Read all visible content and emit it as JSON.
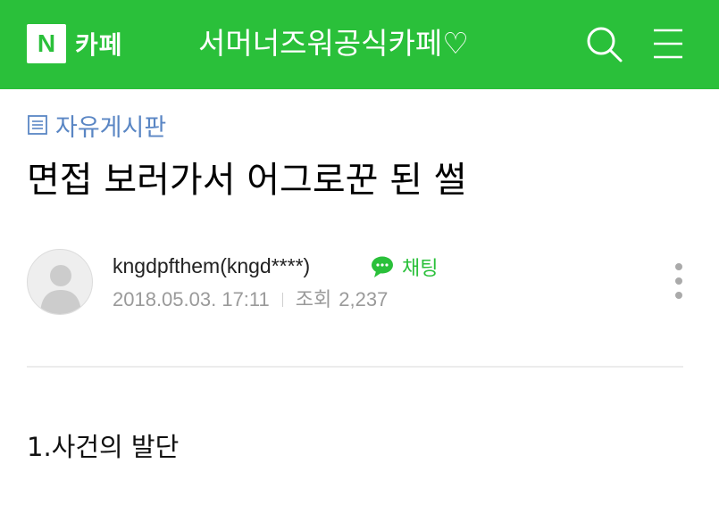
{
  "header": {
    "logo_badge": "N",
    "logo_text": "카페",
    "cafe_name": "서머너즈워공식카페♡",
    "background_color": "#2ac03a",
    "search_icon": "search-icon",
    "menu_icon": "hamburger-menu-icon"
  },
  "post": {
    "board_name": "자유게시판",
    "title": "면접 보러가서 어그로꾼 된 썰",
    "author": "kngdpfthem(kngd****)",
    "chat_label": "채팅",
    "date": "2018.05.03. 17:11",
    "views_label": "조회",
    "views": "2,237",
    "body_heading": "1.사건의 발단",
    "link_color": "#5a86c4",
    "accent_color": "#2ac03a"
  }
}
